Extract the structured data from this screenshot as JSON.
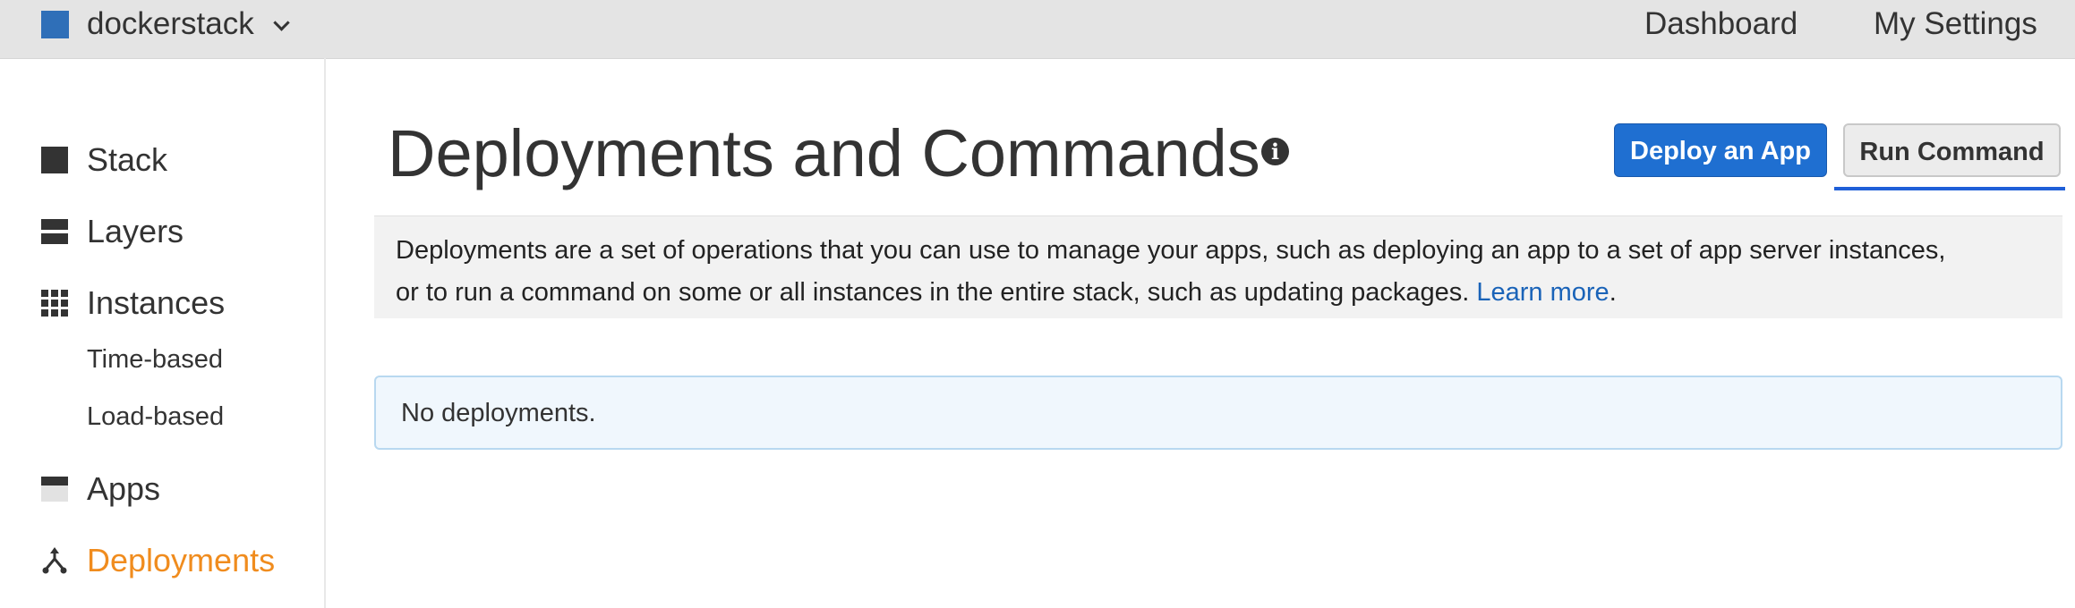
{
  "header": {
    "stack_name": "dockerstack",
    "links": {
      "dashboard": "Dashboard",
      "settings": "My Settings"
    }
  },
  "sidebar": {
    "items": [
      {
        "label": "Stack",
        "icon": "stack-icon"
      },
      {
        "label": "Layers",
        "icon": "layers-icon"
      },
      {
        "label": "Instances",
        "icon": "instances-grid-icon"
      },
      {
        "label": "Apps",
        "icon": "apps-icon"
      },
      {
        "label": "Deployments",
        "icon": "deployments-icon",
        "active": true
      }
    ],
    "subitems": [
      "Time-based",
      "Load-based"
    ]
  },
  "main": {
    "title": "Deployments and Commands",
    "info_icon": "i",
    "buttons": {
      "deploy": "Deploy an App",
      "run": "Run Command"
    },
    "description": {
      "line1": "Deployments are a set of operations that you can use to manage your apps, such as deploying an app to a set of app server instances,",
      "line2": "or to run a command on some or all instances in the entire stack, such as updating packages.",
      "link": "Learn more",
      "end": "."
    },
    "empty_text": "No deployments."
  },
  "colors": {
    "accent": "#1f6fd1",
    "active_nav": "#f08c1e",
    "link": "#1a63b8",
    "logo": "#2f6fb8"
  }
}
